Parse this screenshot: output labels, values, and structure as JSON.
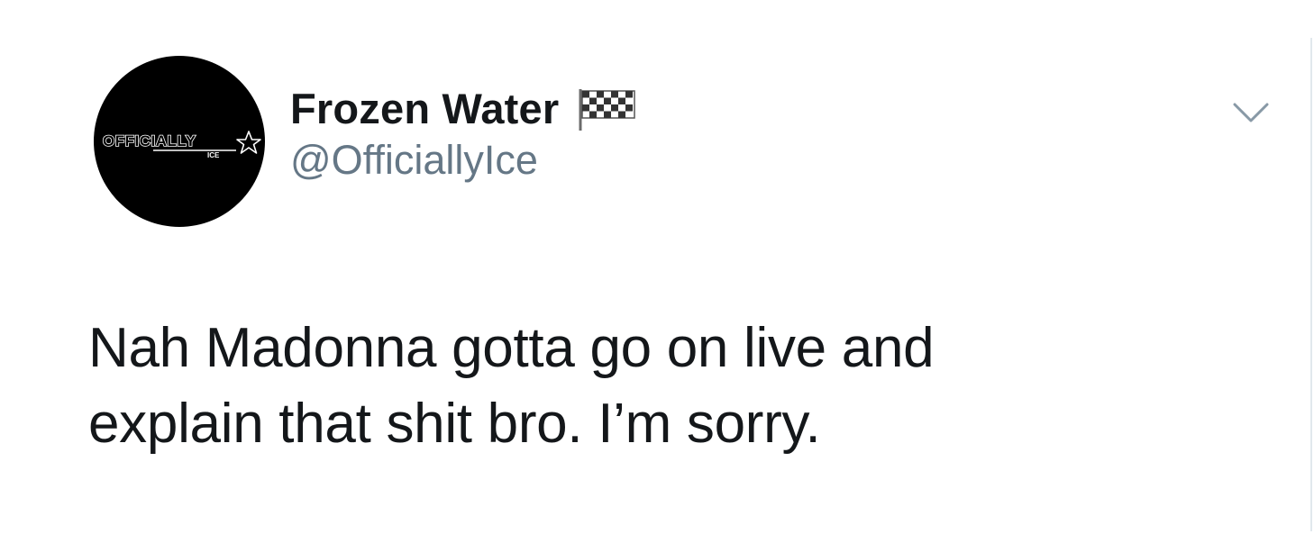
{
  "tweet": {
    "author": {
      "display_name": "Frozen Water",
      "handle": "@OfficiallyIce",
      "avatar_text": "OFFICIALLY",
      "avatar_subtext": "ICE",
      "name_emoji": "chequered-flag-icon"
    },
    "text_lines": [
      "Nah Madonna gotta go on live and",
      "explain that shit bro. I’m sorry."
    ],
    "menu_icon": "chevron-down-icon"
  },
  "colors": {
    "text_primary": "#14171a",
    "text_secondary": "#657786",
    "avatar_bg": "#000000",
    "divider": "#e1e8ed"
  }
}
